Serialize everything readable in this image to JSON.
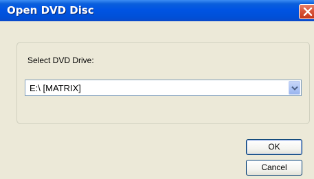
{
  "window": {
    "title": "Open DVD Disc"
  },
  "form": {
    "drive_label": "Select DVD Drive:",
    "drive_selected": "E:\\ [MATRIX]"
  },
  "buttons": {
    "ok_label": "OK",
    "cancel_label": "Cancel"
  },
  "icons": {
    "close": "close-icon",
    "dropdown": "chevron-down-icon"
  },
  "colors": {
    "titlebar": "#0054e3",
    "close_button": "#d9553a",
    "dialog_background": "#ece9d8"
  }
}
